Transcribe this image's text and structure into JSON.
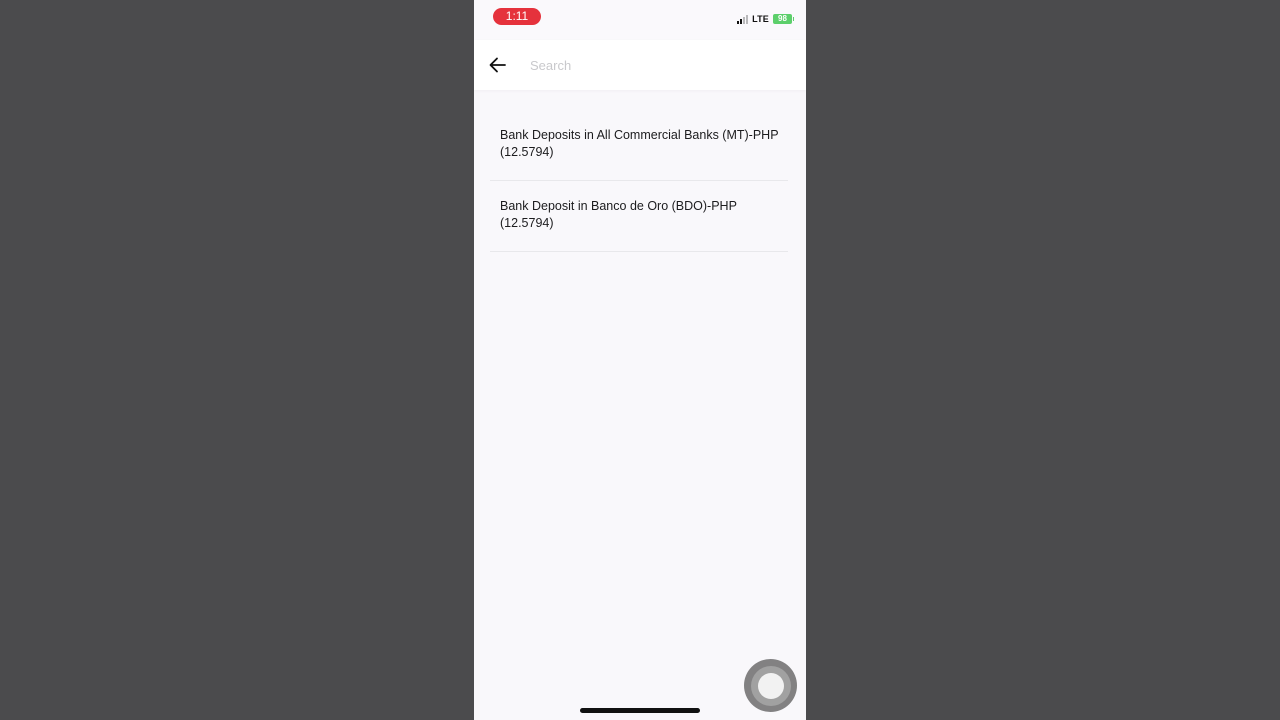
{
  "status_bar": {
    "time": "1:11",
    "network": "LTE",
    "battery": "98"
  },
  "search": {
    "placeholder": "Search",
    "value": ""
  },
  "results": [
    {
      "line1": "Bank Deposits in All Commercial Banks (MT)-PHP",
      "line2": "(12.5794)"
    },
    {
      "line1": "Bank Deposit in Banco de Oro (BDO)-PHP",
      "line2": "(12.5794)"
    }
  ],
  "icons": {
    "back": "back-arrow-icon",
    "signal": "signal-icon",
    "battery": "battery-icon",
    "assistive": "assistive-touch-icon"
  },
  "colors": {
    "time_pill": "#e5323c",
    "battery": "#5ccf6b",
    "background": "#f9f8fb"
  }
}
